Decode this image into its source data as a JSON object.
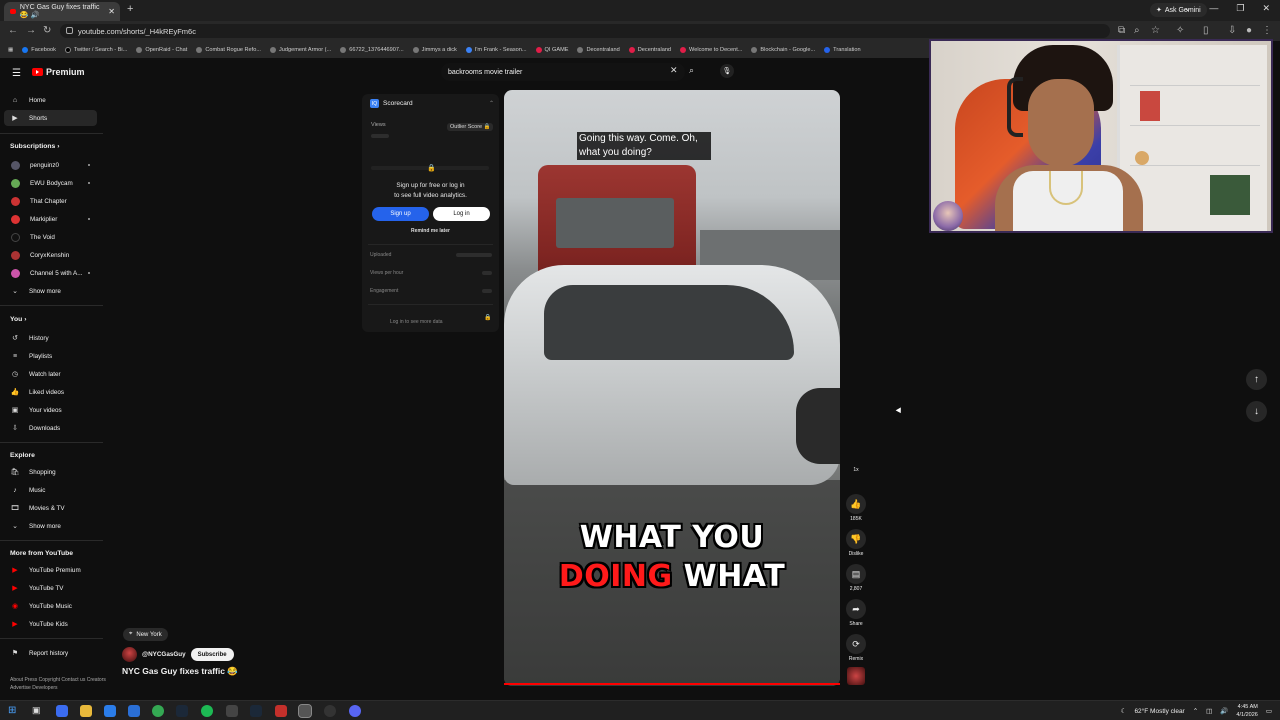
{
  "browser": {
    "tab_title": "NYC Gas Guy fixes traffic 😂 🔊",
    "url": "youtube.com/shorts/_H4kREyFm6c",
    "ask_gemini": "Ask Gemini",
    "bookmarks": [
      "Facebook",
      "Twitter / Search - Bi...",
      "OpenRaid - Chat",
      "Combat Rogue Refo...",
      "Judgement Armor (...",
      "66722_1376446907...",
      "Jimmys a dick",
      "I'm Frank - Season...",
      "QI GAME",
      "Decentraland",
      "Decentraland",
      "Welcome to Decent...",
      "Blockchain - Google...",
      "Translation"
    ]
  },
  "youtube": {
    "logo_label": "Premium",
    "search_value": "backrooms movie trailer",
    "sidebar": {
      "home": "Home",
      "shorts": "Shorts",
      "subscriptions_header": "Subscriptions",
      "channels": [
        "penguinz0",
        "EWU Bodycam",
        "That Chapter",
        "Markiplier",
        "The Void",
        "CoryxKenshin",
        "Channel 5 with A..."
      ],
      "show_more_1": "Show more",
      "you_header": "You",
      "you_items": [
        "History",
        "Playlists",
        "Watch later",
        "Liked videos",
        "Your videos",
        "Downloads"
      ],
      "explore_header": "Explore",
      "explore_items": [
        "Shopping",
        "Music",
        "Movies & TV"
      ],
      "show_more_2": "Show more",
      "more_header": "More from YouTube",
      "more_items": [
        "YouTube Premium",
        "YouTube TV",
        "YouTube Music",
        "YouTube Kids"
      ],
      "report_history": "Report history",
      "footer": "About  Press  Copyright  Contact us  Creators  Advertise  Developers"
    },
    "scorecard": {
      "title": "Scorecard",
      "views_label": "Views",
      "outlier_label": "Outlier Score 🔒",
      "signup_text_1": "Sign up for free or log in",
      "signup_text_2": "to see full video analytics.",
      "signup_btn": "Sign up",
      "login_btn": "Log in",
      "remind": "Remind me later",
      "uploaded": "Uploaded",
      "views_per_hour": "Views per hour",
      "engagement": "Engagement",
      "login_more": "Log in to see more data"
    },
    "video": {
      "caption_top": "Going this way. Come. Oh, what you doing?",
      "caption_big_1": "WHAT YOU",
      "caption_big_2_red": "DOING",
      "caption_big_2_white": " WHAT"
    },
    "actions": {
      "speed": "1x",
      "likes": "185K",
      "dislike": "Dislike",
      "comments": "2,807",
      "share": "Share",
      "remix": "Remix"
    },
    "channel": {
      "location": "New York",
      "handle": "@NYCGasGuy",
      "subscribe": "Subscribe",
      "title": "NYC Gas Guy fixes traffic 😂"
    }
  },
  "taskbar": {
    "weather": "62°F  Mostly clear",
    "time": "4:45 AM",
    "date": "4/1/2026"
  },
  "colors": {
    "yt_red": "#ff0000",
    "caption_red": "#ff1a1a",
    "signup_blue": "#2563eb",
    "page_bg": "#0f0f0f"
  }
}
